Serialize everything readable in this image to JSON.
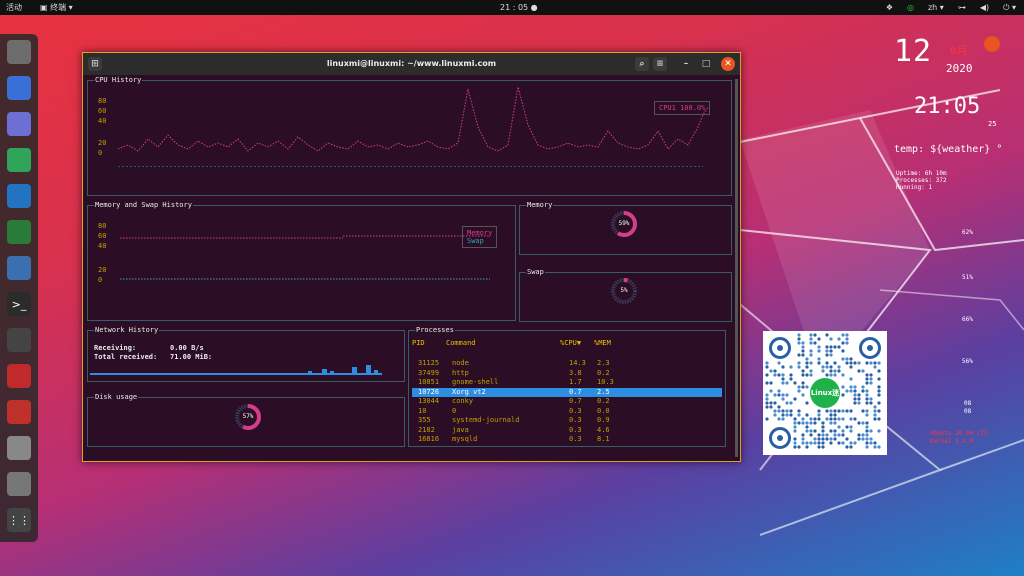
{
  "topbar": {
    "activities": "活动",
    "app_menu": "终端",
    "clock": "21 : 05",
    "lang": "zh"
  },
  "dock": {
    "items": [
      {
        "name": "files-icon",
        "color": "#6c6c6c"
      },
      {
        "name": "screenshot-icon",
        "color": "#3a6fd8"
      },
      {
        "name": "settings-toggle-icon",
        "color": "#6d6fd5"
      },
      {
        "name": "android-studio-icon",
        "color": "#2fa45a"
      },
      {
        "name": "vscode-icon",
        "color": "#2273c2"
      },
      {
        "name": "camera-icon",
        "color": "#2a7a3a"
      },
      {
        "name": "python-icon",
        "color": "#3b6fb0"
      },
      {
        "name": "terminal-icon",
        "color": "#2b2b2b"
      },
      {
        "name": "calculator-icon",
        "color": "#444"
      },
      {
        "name": "web-icon",
        "color": "#c02a2a"
      },
      {
        "name": "system-monitor-icon",
        "color": "#c0302a"
      },
      {
        "name": "dvd-icon",
        "color": "#888"
      },
      {
        "name": "usb-icon",
        "color": "#777"
      },
      {
        "name": "app-grid-icon",
        "color": "#444"
      }
    ]
  },
  "conky": {
    "day": "12",
    "month": "6月",
    "year": "2020",
    "time": "21:05",
    "seconds": "25",
    "temp": "temp: ${weather} °",
    "uptime": "Uptime: 6h 10m",
    "processes": "Processes: 372",
    "running": "Running: 1",
    "stats": [
      "62%",
      "51%",
      "66%",
      "56%",
      "08",
      "08"
    ],
    "footer1": "Ubuntu 20.04 LTS",
    "footer2": "Kernel 5.4.0"
  },
  "window": {
    "title": "linuxmi@linuxmi: ~/www.linuxmi.com"
  },
  "term": {
    "cpu_title": "CPU History",
    "cpu_axis": [
      "80",
      "60",
      "40",
      "20",
      "0"
    ],
    "cpu_legend": "CPU1 100.0%",
    "mem_hist_title": "Memory and Swap History",
    "mem_axis": [
      "80",
      "60",
      "40",
      "20",
      "0"
    ],
    "mem_legend_mem": "Memory",
    "mem_legend_swap": "Swap",
    "memory_title": "Memory",
    "memory_pct": "59%",
    "swap_title": "Swap",
    "swap_pct": "5%",
    "net_title": "Network History",
    "net_receiving_label": "Receiving:",
    "net_receiving_value": "0.00 B/s",
    "net_total_label": "Total received:",
    "net_total_value": "71.00 MiB:",
    "disk_title": "Disk usage",
    "disk_pct": "57%",
    "proc_title": "Processes",
    "proc_headers": {
      "pid": "PID",
      "cmd": "Command",
      "cpu": "%CPU▼",
      "mem": "%MEM"
    },
    "processes": [
      {
        "pid": "31125",
        "cmd": "node",
        "cpu": "14.3",
        "mem": "2.3"
      },
      {
        "pid": "37499",
        "cmd": "http",
        "cpu": "3.8",
        "mem": "0.2"
      },
      {
        "pid": "10851",
        "cmd": "gnome-shell",
        "cpu": "1.7",
        "mem": "10.3"
      },
      {
        "pid": "10726",
        "cmd": "Xorg vt2",
        "cpu": "0.7",
        "mem": "2.5"
      },
      {
        "pid": "13044",
        "cmd": "conky",
        "cpu": "0.7",
        "mem": "0.2"
      },
      {
        "pid": "10",
        "cmd": "0",
        "cpu": "0.3",
        "mem": "0.0"
      },
      {
        "pid": "355",
        "cmd": "systemd-journald",
        "cpu": "0.3",
        "mem": "0.9"
      },
      {
        "pid": "2182",
        "cmd": "java",
        "cpu": "0.3",
        "mem": "4.6"
      },
      {
        "pid": "16816",
        "cmd": "mysqld",
        "cpu": "0.3",
        "mem": "8.1"
      }
    ]
  },
  "qr": {
    "badge": "Linux迷"
  },
  "colors": {
    "accent": "#e95420",
    "cpu_line": "#d63c8c",
    "mem_line": "#d63c8c",
    "swap_line": "#2aa6b6",
    "net_bar": "#2d8de0",
    "selected_row": "#2d8de0"
  }
}
